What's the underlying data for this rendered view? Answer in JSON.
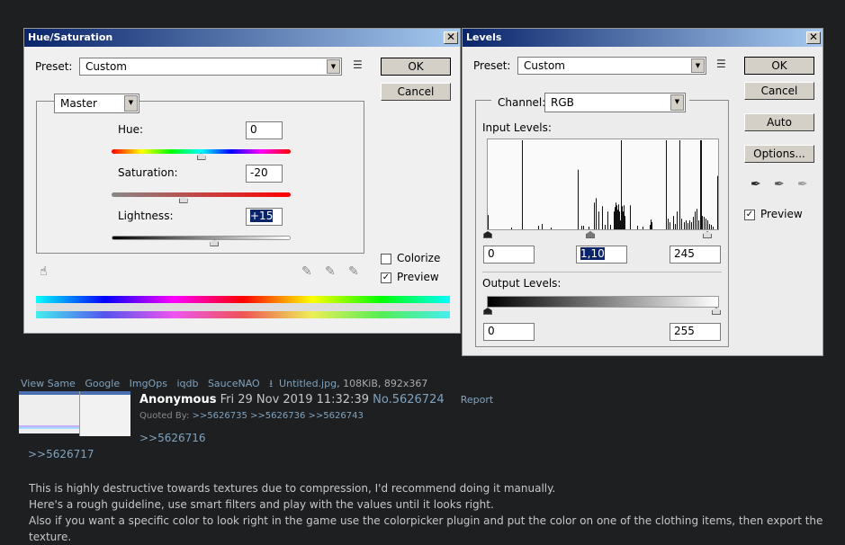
{
  "hue_sat": {
    "title": "Hue/Saturation",
    "close": "✕",
    "preset_label": "Preset:",
    "preset_value": "Custom",
    "ok": "OK",
    "cancel": "Cancel",
    "channel": "Master",
    "hue_label": "Hue:",
    "hue_value": "0",
    "sat_label": "Saturation:",
    "sat_value": "-20",
    "light_label": "Lightness:",
    "light_value": "+15",
    "colorize_label": "Colorize",
    "colorize_checked": false,
    "preview_label": "Preview",
    "preview_checked": true,
    "check": "✓",
    "hue_pos": 0.5,
    "sat_pos": 0.4,
    "light_pos": 0.575
  },
  "levels": {
    "title": "Levels",
    "close": "✕",
    "preset_label": "Preset:",
    "preset_value": "Custom",
    "ok": "OK",
    "cancel": "Cancel",
    "auto": "Auto",
    "options": "Options...",
    "channel_label": "Channel:",
    "channel_value": "RGB",
    "input_label": "Input Levels:",
    "input_black": "0",
    "input_gamma": "1,10",
    "input_white": "245",
    "output_label": "Output Levels:",
    "output_black": "0",
    "output_white": "255",
    "preview_label": "Preview",
    "preview_checked": true,
    "check": "✓",
    "histogram": [
      [
        0,
        0.16
      ],
      [
        26,
        0.02
      ],
      [
        38,
        1.0
      ],
      [
        56,
        0.04
      ],
      [
        60,
        0.06
      ],
      [
        70,
        0.02
      ],
      [
        100,
        0.67
      ],
      [
        104,
        0.04
      ],
      [
        106,
        0.04
      ],
      [
        112,
        0.03
      ],
      [
        118,
        0.3
      ],
      [
        120,
        0.35
      ],
      [
        123,
        0.2
      ],
      [
        127,
        0.26
      ],
      [
        130,
        0.05
      ],
      [
        133,
        0.2
      ],
      [
        136,
        0.05
      ],
      [
        140,
        0.2
      ],
      [
        141,
        0.25
      ],
      [
        142,
        0.3
      ],
      [
        143,
        0.27
      ],
      [
        144,
        0.22
      ],
      [
        145,
        0.28
      ],
      [
        146,
        0.2
      ],
      [
        147,
        0.1
      ],
      [
        148,
        1.0
      ],
      [
        149,
        0.26
      ],
      [
        150,
        0.2
      ],
      [
        151,
        0.27
      ],
      [
        152,
        0.15
      ],
      [
        158,
        0.27
      ],
      [
        166,
        0.04
      ],
      [
        172,
        0.03
      ],
      [
        180,
        0.05
      ],
      [
        181,
        0.11
      ],
      [
        182,
        0.08
      ],
      [
        198,
        1.0
      ],
      [
        200,
        0.12
      ],
      [
        202,
        0.08
      ],
      [
        206,
        0.15
      ],
      [
        208,
        0.06
      ],
      [
        210,
        0.2
      ],
      [
        213,
        1.0
      ],
      [
        215,
        0.12
      ],
      [
        218,
        0.08
      ],
      [
        220,
        0.1
      ],
      [
        222,
        0.07
      ],
      [
        224,
        0.1
      ],
      [
        226,
        0.08
      ],
      [
        228,
        0.14
      ],
      [
        230,
        0.2
      ],
      [
        232,
        0.23
      ],
      [
        234,
        0.1
      ],
      [
        236,
        1.0
      ],
      [
        237,
        1.0
      ],
      [
        238,
        0.15
      ],
      [
        240,
        0.14
      ],
      [
        242,
        0.12
      ],
      [
        244,
        0.1
      ],
      [
        246,
        0.06
      ],
      [
        248,
        0.05
      ],
      [
        250,
        0.03
      ],
      [
        255,
        0.6
      ]
    ]
  },
  "post": {
    "links": [
      "View Same",
      "Google",
      "ImgOps",
      "iqdb",
      "SauceNAO"
    ],
    "download_icon": "download-icon",
    "file_name": "Untitled.jpg",
    "file_info": ", 108KiB, 892x367",
    "name": "Anonymous",
    "date": "Fri 29 Nov 2019 11:32:39",
    "number": "No.5626724",
    "report": "Report",
    "quoted_by_label": "Quoted By:",
    "quoted_by": [
      ">>5626735",
      ">>5626736",
      ">>5626743"
    ],
    "quote1": ">>5626716",
    "quote2": ">>5626717",
    "lines": [
      "This is highly destructive towards textures due to compression, I'd recommend doing it manually.",
      "Here's a rough guideline, use smart filters and play with the values until it looks right.",
      "Also if you want a specific color to look right in the game use the colorpicker plugin and put the color on one of the clothing items, then export the texture."
    ]
  }
}
